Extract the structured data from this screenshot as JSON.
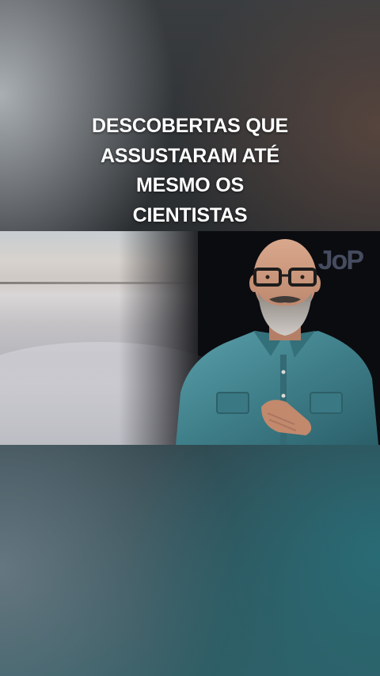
{
  "overlay_title": {
    "lines": [
      "DESCOBERTAS QUE",
      "ASSUSTARAM ATÉ",
      "MESMO OS",
      "CIENTISTAS"
    ]
  },
  "video": {
    "watermark_text": "JoP"
  },
  "colors": {
    "title_text": "#ffffff",
    "backdrop_top": "#3a3d40",
    "backdrop_bottom": "#2f5b62",
    "shirt": "#3f7f8a"
  }
}
